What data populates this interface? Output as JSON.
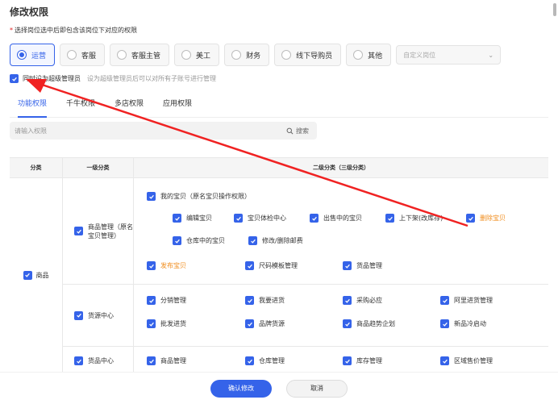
{
  "page_title": "修改权限",
  "hint": {
    "required_mark": "*",
    "text": "选择岗位选中后即包含该岗位下对应的权限"
  },
  "roles": [
    {
      "label": "运营",
      "active": true
    },
    {
      "label": "客服",
      "active": false
    },
    {
      "label": "客服主管",
      "active": false
    },
    {
      "label": "美工",
      "active": false
    },
    {
      "label": "财务",
      "active": false
    },
    {
      "label": "线下导购员",
      "active": false
    },
    {
      "label": "其他",
      "active": false
    }
  ],
  "custom_role": {
    "placeholder": "自定义岗位"
  },
  "super_admin": {
    "label": "同时设为超级管理员",
    "desc": "设为超级管理员后可以对所有子账号进行管理",
    "checked": true
  },
  "tabs": [
    {
      "label": "功能权限",
      "active": true
    },
    {
      "label": "千牛权限",
      "active": false
    },
    {
      "label": "多店权限",
      "active": false
    },
    {
      "label": "应用权限",
      "active": false
    }
  ],
  "search": {
    "placeholder": "请输入权限",
    "button": "搜索"
  },
  "table": {
    "headers": {
      "category": "分类",
      "level1": "一级分类",
      "level2": "二级分类（三级分类）"
    },
    "category": "商品",
    "rows": [
      {
        "level1": "商品管理（原名宝贝管理）",
        "parent": "我的宝贝（原名宝贝操作权限）",
        "children_row1": [
          "编辑宝贝",
          "宝贝体检中心",
          "出售中的宝贝",
          "上下架(改库存)",
          "删除宝贝"
        ],
        "children_row2": [
          "仓库中的宝贝",
          "修改/删除邮费"
        ],
        "others": [
          "发布宝贝",
          "尺码模板管理",
          "货品管理"
        ]
      },
      {
        "level1": "货源中心",
        "items_row1": [
          "分销管理",
          "我要进货",
          "采购必应",
          "阿里进货管理"
        ],
        "items_row2": [
          "批发进货",
          "品牌货源",
          "商品趋势企划",
          "新品冷启动"
        ]
      },
      {
        "level1": "货品中心",
        "items_row1": [
          "商品管理",
          "仓库管理",
          "库存管理",
          "区域售价管理"
        ]
      }
    ]
  },
  "footer": {
    "confirm": "确认修改",
    "cancel": "取消"
  },
  "colors": {
    "accent": "#3563e9",
    "highlight": "#f08c1c",
    "annotation_arrow": "#f02222"
  }
}
